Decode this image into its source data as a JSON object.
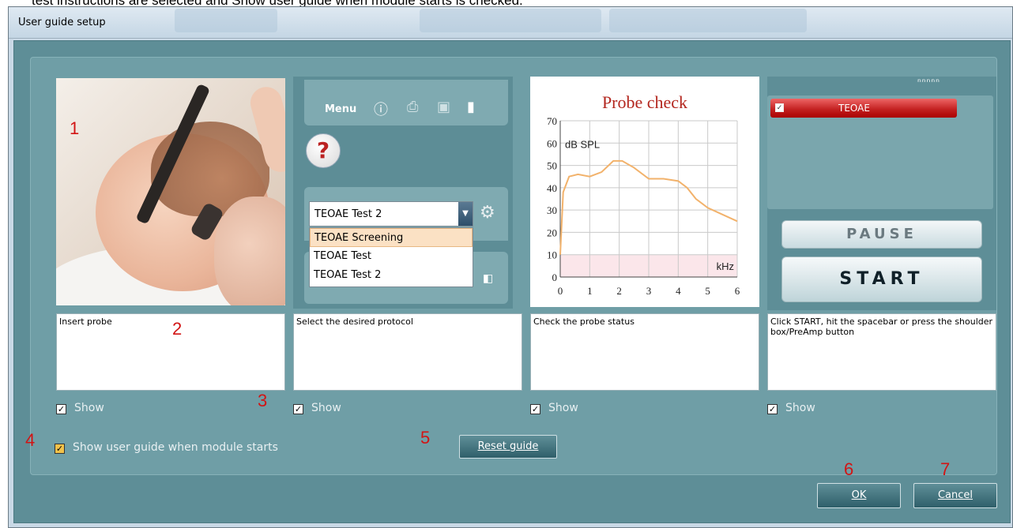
{
  "caption_fragment": "test instructions are selected and Show user guide when module starts is checked.",
  "window": {
    "title": "User guide setup"
  },
  "panel2": {
    "menu_label": "Menu",
    "protocol_selected": "TEOAE Test 2",
    "protocol_options": [
      "TEOAE Screening",
      "TEOAE Test",
      "TEOAE Test 2"
    ],
    "highlighted_option": "TEOAE Screening",
    "icons": [
      "info-icon",
      "print-icon",
      "save-icon",
      "exit-door-icon",
      "ear-icon",
      "settings-gear-icon"
    ]
  },
  "panel3": {
    "title": "Probe check",
    "ylabel": "dB SPL",
    "xlabel": "kHz"
  },
  "panel4": {
    "spinner": "ⁿⁿⁿⁿⁿ",
    "test_item": "TEOAE",
    "pause_label": "PAUSE",
    "start_label": "START"
  },
  "instructions": [
    "Insert probe",
    "Select the desired protocol",
    "Check the probe status",
    "Click START, hit the spacebar or press the shoulder box/PreAmp button"
  ],
  "show_label": "Show",
  "show_checked": [
    true,
    true,
    true,
    true
  ],
  "guide_checkbox_label": "Show user guide when module starts",
  "guide_checkbox_checked": true,
  "reset_button": "Reset guide",
  "ok_button": "OK",
  "cancel_button": "Cancel",
  "callouts": [
    "1",
    "2",
    "3",
    "4",
    "5",
    "6",
    "7"
  ],
  "chart_data": {
    "type": "line",
    "title": "Probe check",
    "xlabel": "kHz",
    "ylabel": "dB SPL",
    "xlim": [
      0,
      6
    ],
    "ylim": [
      0,
      70
    ],
    "xticks": [
      0,
      1,
      2,
      3,
      4,
      5,
      6
    ],
    "yticks": [
      0,
      10,
      20,
      30,
      40,
      50,
      60,
      70
    ],
    "grid": true,
    "series": [
      {
        "color": "#f2b26b",
        "x": [
          0.0,
          0.1,
          0.3,
          0.6,
          1.0,
          1.4,
          1.8,
          2.1,
          2.5,
          3.0,
          3.5,
          4.0,
          4.3,
          4.6,
          5.0,
          5.5,
          6.0
        ],
        "y": [
          10,
          38,
          45,
          46,
          45,
          47,
          52,
          52,
          49,
          44,
          44,
          43,
          40,
          35,
          31,
          28,
          25
        ]
      }
    ]
  }
}
